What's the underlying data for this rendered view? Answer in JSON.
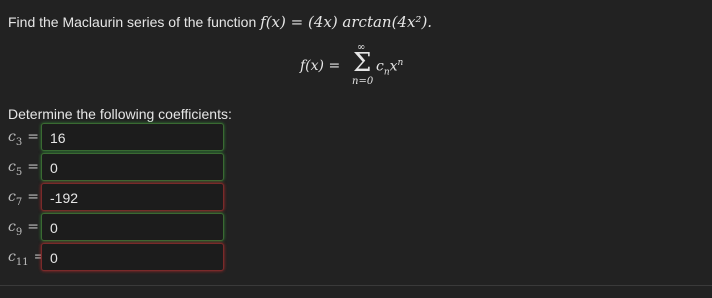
{
  "question": {
    "prefix": "Find the Maclaurin series of the function",
    "function": "f(x) = (4x) arctan(4x²)."
  },
  "formula": {
    "lhs": "f(x) =",
    "sigma": "Σ",
    "upper": "∞",
    "lower": "n=0",
    "term_c": "c",
    "term_sub": "n",
    "term_x": "x",
    "term_sup": "n"
  },
  "instruction": "Determine the following coefficients:",
  "coefficients": [
    {
      "base": "c",
      "sub": "3",
      "eq": "=",
      "value": "16",
      "status": "correct"
    },
    {
      "base": "c",
      "sub": "5",
      "eq": "=",
      "value": "0",
      "status": "correct"
    },
    {
      "base": "c",
      "sub": "7",
      "eq": "=",
      "value": "-192",
      "status": "incorrect"
    },
    {
      "base": "c",
      "sub": "9",
      "eq": "=",
      "value": "0",
      "status": "correct"
    },
    {
      "base": "c",
      "sub": "11",
      "eq": "=",
      "value": "0",
      "status": "incorrect"
    }
  ],
  "colors": {
    "background": "#222222",
    "correct": "#2e7d32",
    "incorrect": "#a52a2a"
  }
}
